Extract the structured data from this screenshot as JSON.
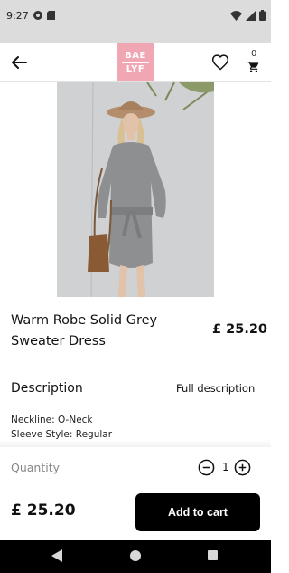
{
  "status_bar": {
    "time": "9:27"
  },
  "header": {
    "logo_line1": "BAE",
    "logo_line2": "LYF",
    "cart_count": "0",
    "icons": [
      "back-arrow-icon",
      "heart-icon",
      "shopping-cart-icon"
    ],
    "logo_color": "#f1a6b4"
  },
  "product": {
    "title": "Warm Robe Solid Grey Sweater Dress",
    "price": "£ 25.20"
  },
  "description": {
    "heading": "Description",
    "full_link": "Full description",
    "specs": [
      "Neckline: O-Neck",
      "Sleeve Style: Regular"
    ]
  },
  "quantity": {
    "label": "Quantity",
    "value": "1"
  },
  "footer": {
    "total": "£ 25.20",
    "add_to_cart": "Add to cart",
    "button_color": "#000000"
  }
}
